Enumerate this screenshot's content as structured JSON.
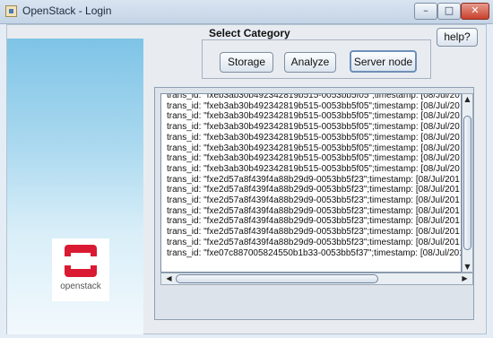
{
  "window": {
    "title": "OpenStack - Login",
    "minimize_glyph": "–",
    "maximize_glyph": "□",
    "close_glyph": "✕"
  },
  "branding": {
    "logo_text": "openstack",
    "logo_icon": "openstack-logo-icon",
    "logo_color": "#da1a32"
  },
  "category": {
    "label": "Select Category",
    "buttons": [
      "Storage",
      "Analyze",
      "Server node"
    ],
    "selected": "Server node"
  },
  "help_button": "help?",
  "log": {
    "lines": [
      "trans_id: \"fxeb3ab30b492342819b515-0053bb5f05\";timestamp: [08/Jul/20",
      "trans_id: \"fxeb3ab30b492342819b515-0053bb5f05\";timestamp: [08/Jul/20",
      "trans_id: \"fxeb3ab30b492342819b515-0053bb5f05\";timestamp: [08/Jul/20",
      "trans_id: \"fxeb3ab30b492342819b515-0053bb5f05\";timestamp: [08/Jul/20",
      "trans_id: \"fxeb3ab30b492342819b515-0053bb5f05\";timestamp: [08/Jul/20",
      "trans_id: \"fxeb3ab30b492342819b515-0053bb5f05\";timestamp: [08/Jul/20",
      "trans_id: \"fxeb3ab30b492342819b515-0053bb5f05\";timestamp: [08/Jul/20",
      "trans_id: \"fxeb3ab30b492342819b515-0053bb5f05\";timestamp: [08/Jul/20",
      "trans_id: \"fxe2d57a8f439f4a88b29d9-0053bb5f23\";timestamp: [08/Jul/201",
      "trans_id: \"fxe2d57a8f439f4a88b29d9-0053bb5f23\";timestamp: [08/Jul/201",
      "trans_id: \"fxe2d57a8f439f4a88b29d9-0053bb5f23\";timestamp: [08/Jul/201",
      "trans_id: \"fxe2d57a8f439f4a88b29d9-0053bb5f23\";timestamp: [08/Jul/201",
      "trans_id: \"fxe2d57a8f439f4a88b29d9-0053bb5f23\";timestamp: [08/Jul/201",
      "trans_id: \"fxe2d57a8f439f4a88b29d9-0053bb5f23\";timestamp: [08/Jul/201",
      "trans_id: \"fxe2d57a8f439f4a88b29d9-0053bb5f23\";timestamp: [08/Jul/201",
      "trans_id: \"fxe07c887005824550b1b33-0053bb5f37\";timestamp: [08/Jul/201"
    ]
  },
  "scrollbars": {
    "up_arrow": "▲",
    "down_arrow": "▼",
    "left_arrow": "◀",
    "right_arrow": "▶"
  }
}
